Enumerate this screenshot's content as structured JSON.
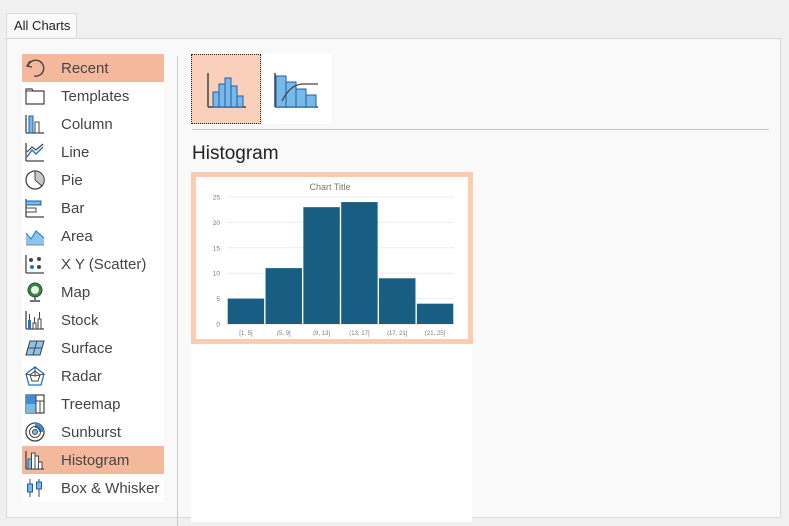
{
  "tabs": [
    {
      "label": "All Charts",
      "active": true
    }
  ],
  "sidebar": {
    "items": [
      {
        "label": "Recent",
        "icon": "recent-icon",
        "selected": true
      },
      {
        "label": "Templates",
        "icon": "templates-folder-icon",
        "selected": false
      },
      {
        "label": "Column",
        "icon": "column-chart-icon",
        "selected": false
      },
      {
        "label": "Line",
        "icon": "line-chart-icon",
        "selected": false
      },
      {
        "label": "Pie",
        "icon": "pie-chart-icon",
        "selected": false
      },
      {
        "label": "Bar",
        "icon": "bar-chart-icon",
        "selected": false
      },
      {
        "label": "Area",
        "icon": "area-chart-icon",
        "selected": false
      },
      {
        "label": "X Y (Scatter)",
        "icon": "scatter-chart-icon",
        "selected": false
      },
      {
        "label": "Map",
        "icon": "map-chart-icon",
        "selected": false
      },
      {
        "label": "Stock",
        "icon": "stock-chart-icon",
        "selected": false
      },
      {
        "label": "Surface",
        "icon": "surface-chart-icon",
        "selected": false
      },
      {
        "label": "Radar",
        "icon": "radar-chart-icon",
        "selected": false
      },
      {
        "label": "Treemap",
        "icon": "treemap-chart-icon",
        "selected": false
      },
      {
        "label": "Sunburst",
        "icon": "sunburst-chart-icon",
        "selected": false
      },
      {
        "label": "Histogram",
        "icon": "histogram-chart-icon",
        "selected": true
      },
      {
        "label": "Box & Whisker",
        "icon": "box-whisker-chart-icon",
        "selected": false
      }
    ]
  },
  "subtypes": [
    {
      "name": "Histogram",
      "icon": "histogram-subtype-icon",
      "selected": true
    },
    {
      "name": "Pareto",
      "icon": "pareto-subtype-icon",
      "selected": false
    }
  ],
  "preview": {
    "heading": "Histogram"
  },
  "colors": {
    "selection": "#f4b99c",
    "bar": "#175e82",
    "preview_border": "#fbcbb2"
  },
  "chart_data": {
    "type": "bar",
    "title": "Chart Title",
    "categories": [
      "[1, 5]",
      "(5, 9]",
      "(9, 13]",
      "(13, 17]",
      "(17, 21]",
      "(21, 25]"
    ],
    "values": [
      5,
      11,
      23,
      24,
      9,
      4
    ],
    "xlabel": "",
    "ylabel": "",
    "ylim": [
      0,
      25
    ],
    "yticks": [
      0,
      5,
      10,
      15,
      20,
      25
    ],
    "grid": true,
    "legend": "none"
  }
}
